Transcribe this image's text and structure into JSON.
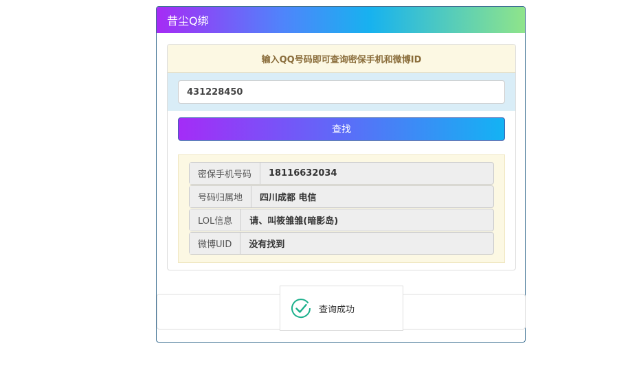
{
  "panel": {
    "title": "昔尘Q绑"
  },
  "query": {
    "hint": "输入QQ号码即可查询密保手机和微博ID",
    "input_value": "431228450",
    "search_label": "查找"
  },
  "results": [
    {
      "label": "密保手机号码",
      "value": "18116632034"
    },
    {
      "label": "号码归属地",
      "value": "四川成都 电信"
    },
    {
      "label": "LOL信息",
      "value": "请、叫筱雏雏(暗影岛)"
    },
    {
      "label": "微博UID",
      "value": "没有找到"
    }
  ],
  "toast": {
    "icon": "check-circle-icon",
    "message": "查询成功",
    "color": "#1aaf8b"
  }
}
